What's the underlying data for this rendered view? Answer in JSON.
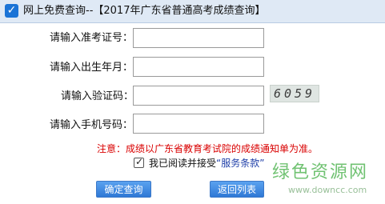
{
  "header": {
    "title": "网上免费查询--【2017年广东省普通高考成绩查询】"
  },
  "form": {
    "exam_number_label": "请输入准考证号：",
    "birth_label": "请输入出生年月：",
    "captcha_label": "请输入验证码：",
    "phone_label": "请输入手机号码：",
    "exam_number_value": "",
    "birth_value": "",
    "captcha_value": "",
    "phone_value": "",
    "captcha_image_text": "6059"
  },
  "notice": "注意：成绩以广东省教育考试院的成绩通知单为准。",
  "agreement": {
    "text": "我已阅读并接受",
    "link": "“服务条款”",
    "checked": true
  },
  "buttons": {
    "submit": "确定查询",
    "back": "返回列表"
  },
  "watermark": {
    "title": "绿色资源网",
    "url": "www.downcc.com"
  },
  "colors": {
    "header_bg": "#dfe9f5",
    "accent_blue": "#1a73d6",
    "notice_red": "#d90000",
    "watermark_green": "#58b85a"
  }
}
